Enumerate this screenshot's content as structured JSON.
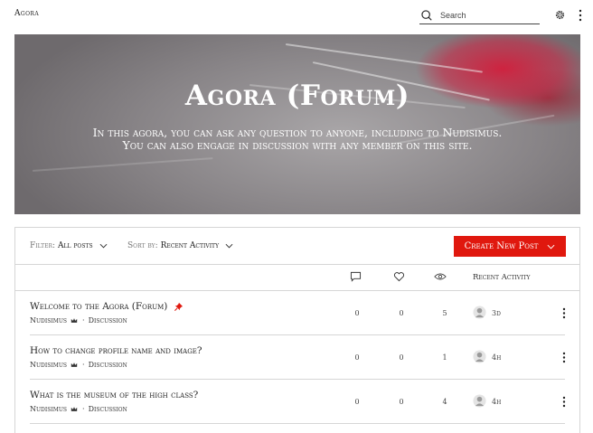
{
  "header": {
    "brand": "Agora",
    "search_placeholder": "Search"
  },
  "hero": {
    "title": "Agora (Forum)",
    "description": "In this agora, you can ask any question to anyone, including to Nudisimus. You can also engage in discussion with any member on this site."
  },
  "toolbar": {
    "filter_label": "Filter:",
    "filter_value": "All posts",
    "sort_label": "Sort by:",
    "sort_value": "Recent Activity",
    "create_label": "Create New Post"
  },
  "columns": {
    "recent_activity": "Recent Activity",
    "icons": [
      "comment-icon",
      "heart-icon",
      "eye-icon"
    ]
  },
  "posts": [
    {
      "title": "Welcome to the Agora (Forum)",
      "pinned": true,
      "author": "Nudisimus",
      "separator": "·",
      "category": "Discussion",
      "comments": "0",
      "likes": "0",
      "views": "5",
      "activity": "3d"
    },
    {
      "title": "How to change profile name and image?",
      "pinned": false,
      "author": "Nudisimus",
      "separator": "·",
      "category": "Discussion",
      "comments": "0",
      "likes": "0",
      "views": "1",
      "activity": "4h"
    },
    {
      "title": "What is the museum of the high class?",
      "pinned": false,
      "author": "Nudisimus",
      "separator": "·",
      "category": "Discussion",
      "comments": "0",
      "likes": "0",
      "views": "4",
      "activity": "4h"
    }
  ],
  "colors": {
    "accent": "#e0180e",
    "border": "#d6d6d6"
  }
}
